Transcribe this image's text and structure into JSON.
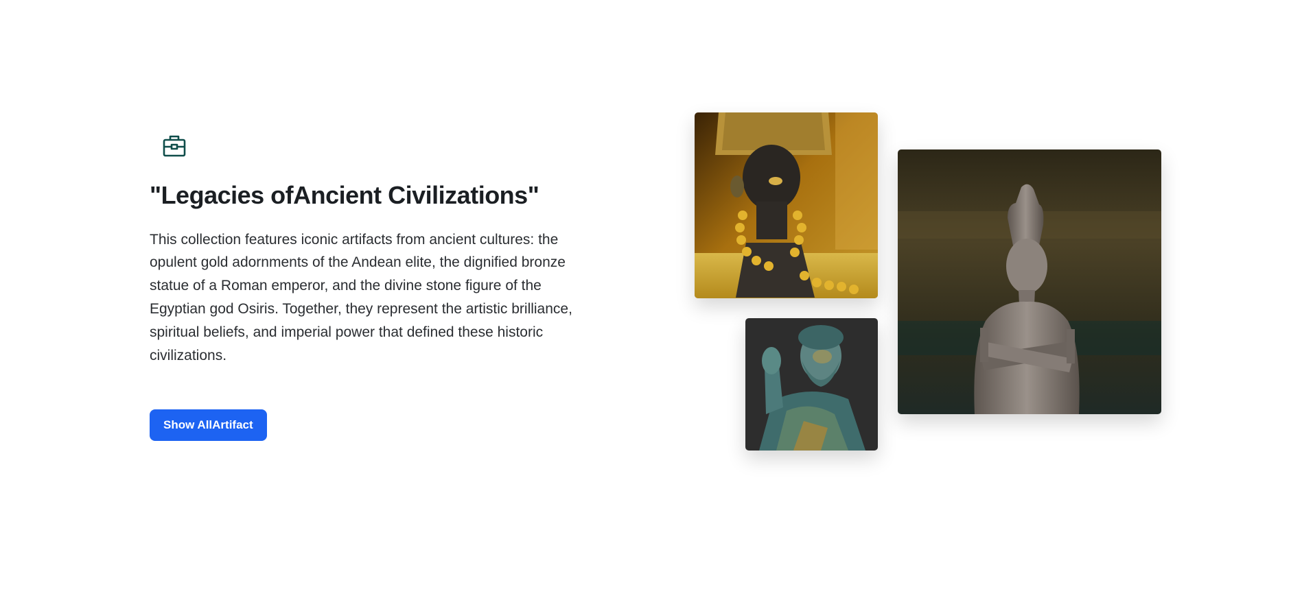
{
  "hero": {
    "icon": "briefcase-icon",
    "title": "\"Legacies ofAncient Civilizations\"",
    "description": "This collection features iconic artifacts from ancient cultures: the opulent gold adornments of the Andean elite, the dignified bronze statue of a Roman emperor, and the divine stone figure of the Egyptian god Osiris. Together, they represent the artistic brilliance, spiritual beliefs, and imperial power that defined these historic civilizations.",
    "button_label": "Show AllArtifact"
  },
  "colors": {
    "accent": "#1d63f2",
    "icon": "#0f4d4a",
    "text": "#1b1f23"
  }
}
